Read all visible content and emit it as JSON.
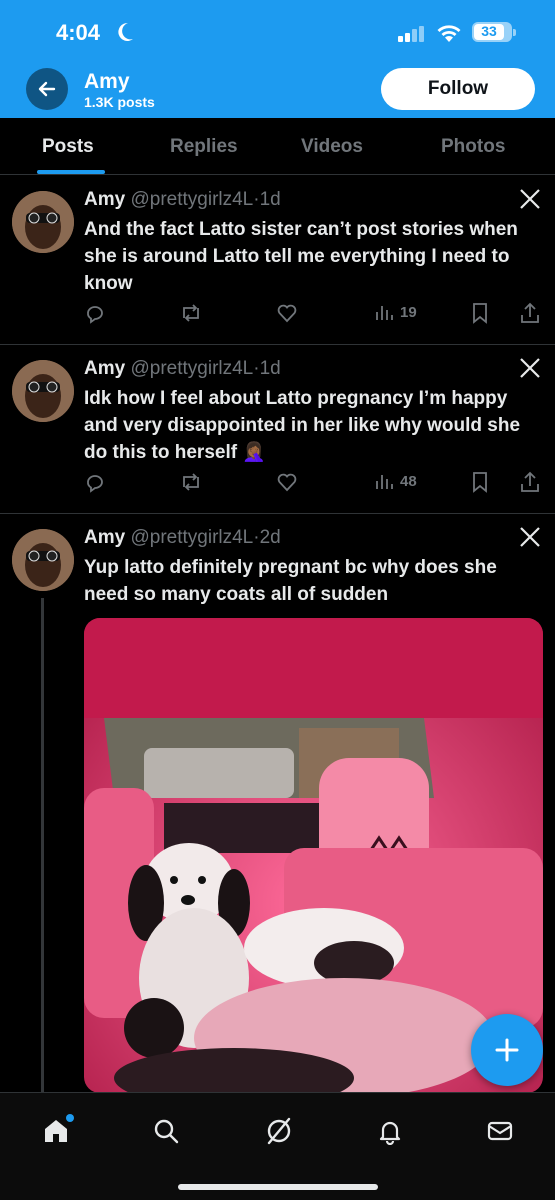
{
  "status_bar": {
    "time": "4:04",
    "battery": "33"
  },
  "header": {
    "name": "Amy",
    "post_count": "1.3K posts",
    "follow_label": "Follow"
  },
  "tabs": [
    {
      "label": "Posts",
      "active": true
    },
    {
      "label": "Replies",
      "active": false
    },
    {
      "label": "Videos",
      "active": false
    },
    {
      "label": "Photos",
      "active": false
    }
  ],
  "posts": [
    {
      "name": "Amy",
      "handle": "@prettygirlz4L",
      "time": "1d",
      "text": "And the fact Latto sister can’t post stories when she is around Latto tell me everything I need to know",
      "views": "19"
    },
    {
      "name": "Amy",
      "handle": "@prettygirlz4L",
      "time": "1d",
      "text": "Idk how I feel about Latto pregnancy I’m happy and very disappointed in her like why would she do this to herself 🤦🏾‍♀️",
      "views": "48"
    },
    {
      "name": "Amy",
      "handle": "@prettygirlz4L",
      "time": "2d",
      "text": "Yup latto definitely pregnant bc why does she need so many coats all of sudden",
      "media": "photo-dog-in-pink-car-interior"
    }
  ],
  "colors": {
    "accent": "#1d9bf0",
    "background": "#000000",
    "muted": "#71767b"
  }
}
